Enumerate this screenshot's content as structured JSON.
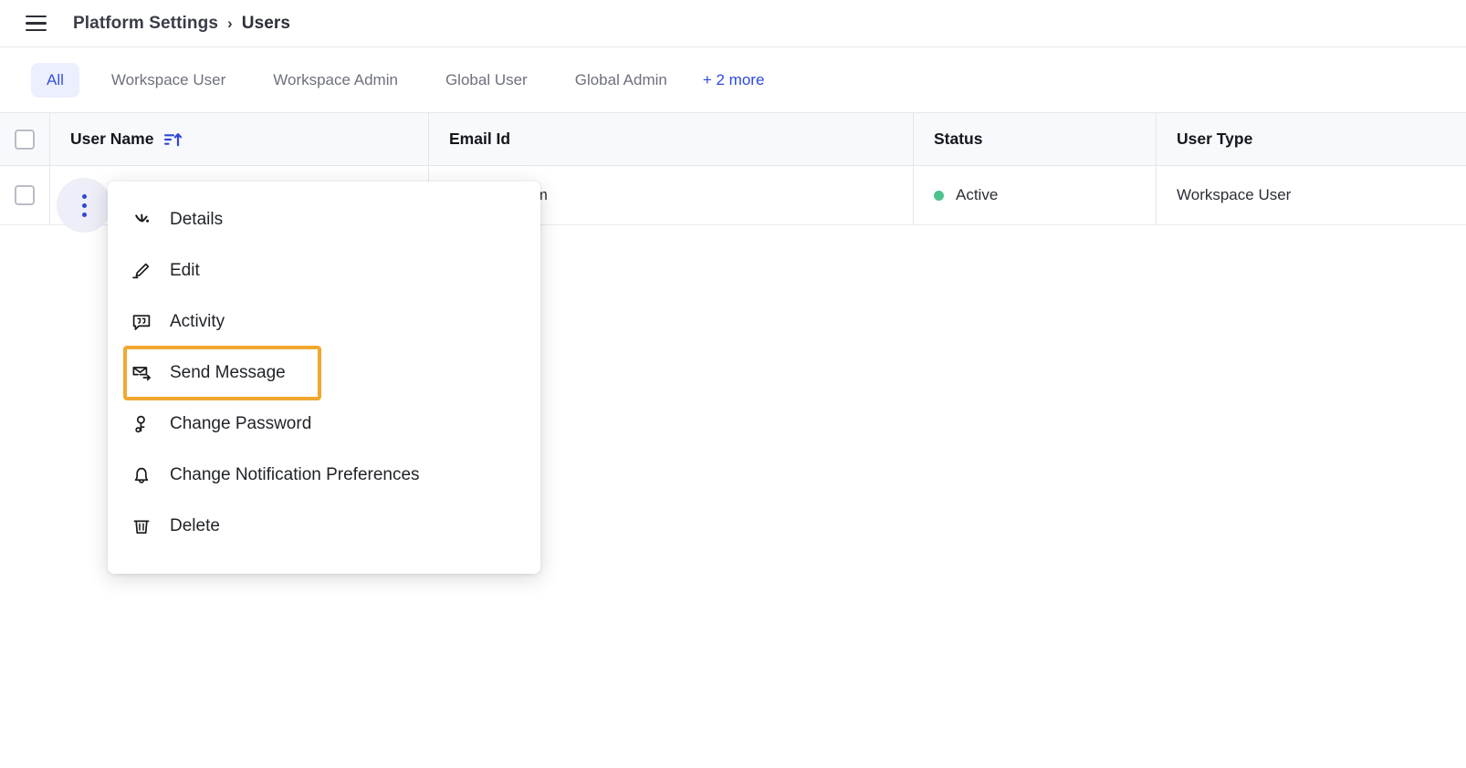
{
  "topbar": {
    "menu_icon": "hamburger-icon",
    "breadcrumb": {
      "parent": "Platform Settings",
      "separator": "›",
      "current": "Users"
    }
  },
  "filters": {
    "tabs": [
      {
        "label": "All",
        "active": true
      },
      {
        "label": "Workspace User",
        "active": false
      },
      {
        "label": "Workspace Admin",
        "active": false
      },
      {
        "label": "Global User",
        "active": false
      },
      {
        "label": "Global Admin",
        "active": false
      }
    ],
    "more_label": "+ 2 more",
    "active_color": "#3452e0",
    "active_bg": "#eceffd",
    "link_color": "#2a4ae0"
  },
  "table": {
    "columns": [
      {
        "key": "select",
        "label": ""
      },
      {
        "key": "user_name",
        "label": "User Name",
        "sort_icon": "sort-ascending-icon",
        "sorted": true
      },
      {
        "key": "email_id",
        "label": "Email Id"
      },
      {
        "key": "status",
        "label": "Status"
      },
      {
        "key": "user_type",
        "label": "User Type"
      }
    ],
    "rows": [
      {
        "user_name": "",
        "email_id": "@sprinklr.com",
        "status": "Active",
        "status_color": "#4cc38a",
        "user_type": "Workspace User"
      }
    ],
    "row_action_icon": "more-vertical-icon"
  },
  "context_menu": {
    "items": [
      {
        "label": "Details",
        "icon": "sparkle-icon",
        "highlighted": false
      },
      {
        "label": "Edit",
        "icon": "pencil-icon",
        "highlighted": false
      },
      {
        "label": "Activity",
        "icon": "quote-bubble-icon",
        "highlighted": false
      },
      {
        "label": "Send Message",
        "icon": "envelope-arrow-icon",
        "highlighted": true
      },
      {
        "label": "Change Password",
        "icon": "user-key-icon",
        "highlighted": false
      },
      {
        "label": "Change Notification Preferences",
        "icon": "bell-icon",
        "highlighted": false
      },
      {
        "label": "Delete",
        "icon": "trash-icon",
        "highlighted": false
      }
    ],
    "highlight_color": "#f0a830"
  }
}
